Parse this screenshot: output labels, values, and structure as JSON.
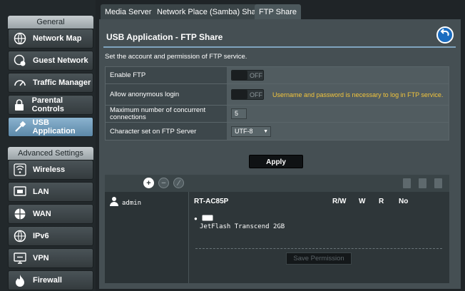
{
  "sidebar": {
    "general_header": "General",
    "advanced_header": "Advanced Settings",
    "items": [
      {
        "label": "Network Map"
      },
      {
        "label": "Guest Network"
      },
      {
        "label": "Traffic Manager"
      },
      {
        "label": "Parental Controls"
      },
      {
        "label": "USB Application"
      }
    ],
    "advanced_items": [
      {
        "label": "Wireless"
      },
      {
        "label": "LAN"
      },
      {
        "label": "WAN"
      },
      {
        "label": "IPv6"
      },
      {
        "label": "VPN"
      },
      {
        "label": "Firewall"
      }
    ]
  },
  "tabs": [
    {
      "label": "Media Server"
    },
    {
      "label": "Network Place (Samba) Share"
    },
    {
      "label": "FTP Share"
    }
  ],
  "page": {
    "title": "USB Application - FTP Share",
    "description": "Set the account and permission of FTP service."
  },
  "form": {
    "enable_ftp": {
      "label": "Enable FTP",
      "state": "OFF"
    },
    "anonymous": {
      "label": "Allow anonymous login",
      "state": "OFF",
      "warning": "Username and password is necessary to log in FTP service."
    },
    "max_conn": {
      "label_line1": "Maximum number of concurrent",
      "label_line2": "connections",
      "value": "5"
    },
    "charset": {
      "label": "Character set on FTP Server",
      "value": "UTF-8"
    }
  },
  "apply_label": "Apply",
  "permissions": {
    "user": "admin",
    "device_name": "RT-AC85P",
    "columns": [
      "R/W",
      "W",
      "R",
      "No"
    ],
    "drive": "JetFlash Transcend 2GB",
    "save_label": "Save Permission"
  },
  "colors": {
    "accent": "#7fa4be",
    "warning": "#f3c53c",
    "active_item": "#5c88a8"
  }
}
